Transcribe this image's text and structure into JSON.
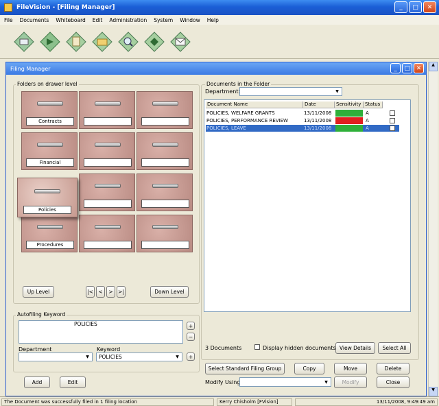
{
  "app": {
    "title": "FileVision - [Filing Manager]"
  },
  "menu": [
    "File",
    "Documents",
    "Whiteboard",
    "Edit",
    "Administration",
    "System",
    "Window",
    "Help"
  ],
  "toolbar": {
    "icons": [
      "scan-icon",
      "import-icon",
      "file-icon",
      "folder-icon",
      "search-icon",
      "refresh-icon",
      "email-icon"
    ]
  },
  "window": {
    "title": "Filing Manager"
  },
  "folders": {
    "group_label": "Folders on drawer level",
    "drawers": [
      "Contracts",
      "",
      "",
      "Financial",
      "",
      "",
      "Policies",
      "",
      "",
      "Procedures",
      "",
      ""
    ],
    "up_level": "Up Level",
    "down_level": "Down Level",
    "pager": [
      "|<",
      "<",
      ">",
      ">|"
    ]
  },
  "autofiling": {
    "group_label": "Autofiling Keyword",
    "text": "POLICIES",
    "department_label": "Department",
    "keyword_label": "Keyword",
    "keyword_value": "POLICIES",
    "plus": "+",
    "minus": "−"
  },
  "documents": {
    "group_label": "Documents in the Folder",
    "department_label": "Department:",
    "columns": [
      "Document Name",
      "Date",
      "Sensitivity",
      "Status"
    ],
    "rows": [
      {
        "name": "POLICIES, WELFARE GRANTS",
        "date": "13/11/2008",
        "sens": "ok",
        "sens_color": "#2fb03a",
        "status": "A"
      },
      {
        "name": "POLICIES, PERFORMANCE REVIEW",
        "date": "13/11/2008",
        "sens": "ok",
        "sens_color": "#e02020",
        "status": "A"
      },
      {
        "name": "POLICIES, LEAVE",
        "date": "13/11/2008",
        "sens": "ok",
        "sens_color": "#2fb03a",
        "status": "A"
      }
    ],
    "count": "3 Documents",
    "display_hidden": "Display hidden documents",
    "view_details": "View Details",
    "select_all": "Select All"
  },
  "actions": {
    "select_group": "Select Standard Filing Group",
    "copy": "Copy",
    "move": "Move",
    "delete": "Delete",
    "modify_using": "Modify Using:",
    "modify": "Modify",
    "close": "Close",
    "add": "Add",
    "edit": "Edit"
  },
  "status": {
    "message": "The Document was successfully filed in 1 filing location",
    "user": "Kerry Chisholm [FVision]",
    "datetime": "13/11/2008, 9:49:49 am"
  }
}
